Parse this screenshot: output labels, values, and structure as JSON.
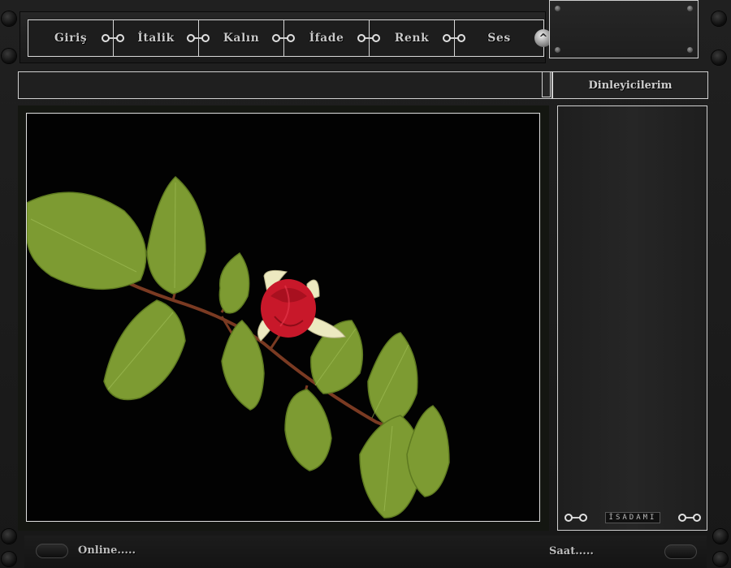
{
  "nav": {
    "items": [
      {
        "label": "Giriş"
      },
      {
        "label": "İtalik"
      },
      {
        "label": "Kalın"
      },
      {
        "label": "İfade"
      },
      {
        "label": "Renk"
      },
      {
        "label": "Ses"
      }
    ]
  },
  "side": {
    "title": "Dinleyicilerim",
    "brand": "İSADAMI"
  },
  "status": {
    "online_label": "Online.....",
    "time_label": "Saat....."
  },
  "colors": {
    "background": "#1c1c1c",
    "border": "#d8d8d8",
    "text": "#c8c8c8",
    "rose": "#c8182a",
    "leaf": "#7a9a2e"
  }
}
